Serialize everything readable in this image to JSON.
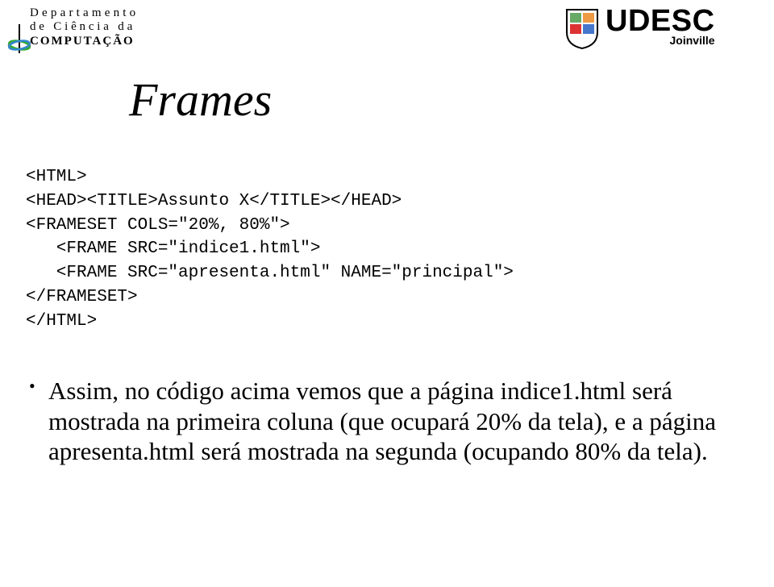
{
  "header": {
    "left_logo": {
      "line1": "Departamento",
      "line2": "de Ciência da",
      "line3": "COMPUTAÇÃO"
    },
    "right_logo": {
      "name": "UDESC",
      "sub": "Joinville"
    }
  },
  "title": "Frames",
  "code": {
    "l1": "<HTML>",
    "l2": "<HEAD><TITLE>Assunto X</TITLE></HEAD>",
    "l3": "<FRAMESET COLS=\"20%, 80%\">",
    "l4": "   <FRAME SRC=\"indice1.html\">",
    "l5": "   <FRAME SRC=\"apresenta.html\" NAME=\"principal\">",
    "l6": "</FRAMESET>",
    "l7": "</HTML>"
  },
  "bullet": "Assim, no código acima vemos que a página indice1.html será mostrada na primeira coluna (que ocupará 20% da tela), e a página apresenta.html será mostrada na segunda (ocupando 80% da tela)."
}
